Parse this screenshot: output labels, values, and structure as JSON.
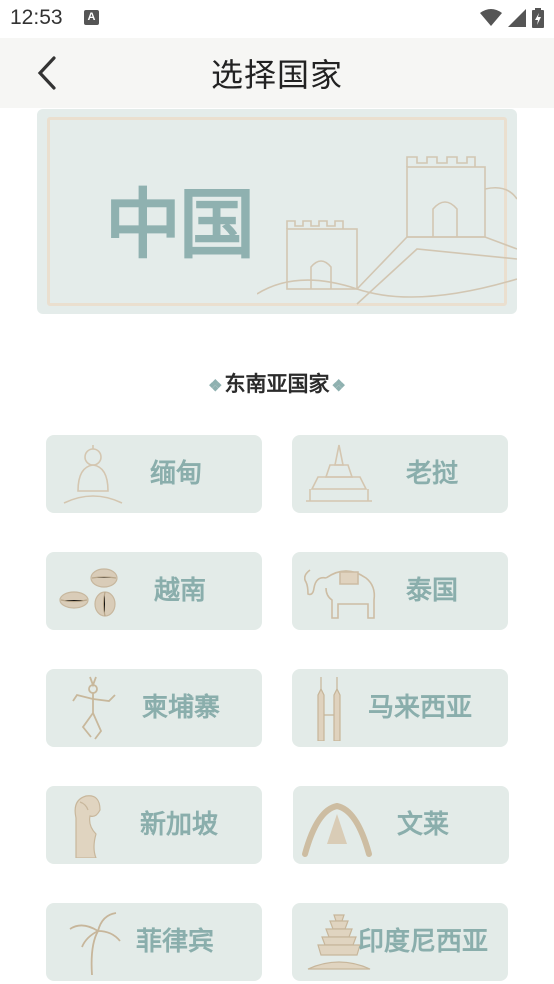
{
  "status": {
    "time": "12:53",
    "notif_icon": "A"
  },
  "header": {
    "title": "选择国家",
    "back_icon": "chevron-left-icon"
  },
  "banner": {
    "title": "中国"
  },
  "section": {
    "title": "东南亚国家"
  },
  "countries": [
    {
      "label": "缅甸",
      "icon": "buddha-icon"
    },
    {
      "label": "老挝",
      "icon": "pagoda-icon"
    },
    {
      "label": "越南",
      "icon": "coffee-beans-icon"
    },
    {
      "label": "泰国",
      "icon": "elephant-icon"
    },
    {
      "label": "柬埔寨",
      "icon": "dancer-icon"
    },
    {
      "label": "马来西亚",
      "icon": "twin-towers-icon"
    },
    {
      "label": "新加坡",
      "icon": "merlion-icon"
    },
    {
      "label": "文莱",
      "icon": "mosque-arch-icon"
    },
    {
      "label": "菲律宾",
      "icon": "palm-tree-icon"
    },
    {
      "label": "印度尼西亚",
      "icon": "temple-icon"
    }
  ],
  "colors": {
    "card_bg": "#e3ebe8",
    "accent": "#8fb1b0",
    "line_art": "#d9cbb7"
  }
}
